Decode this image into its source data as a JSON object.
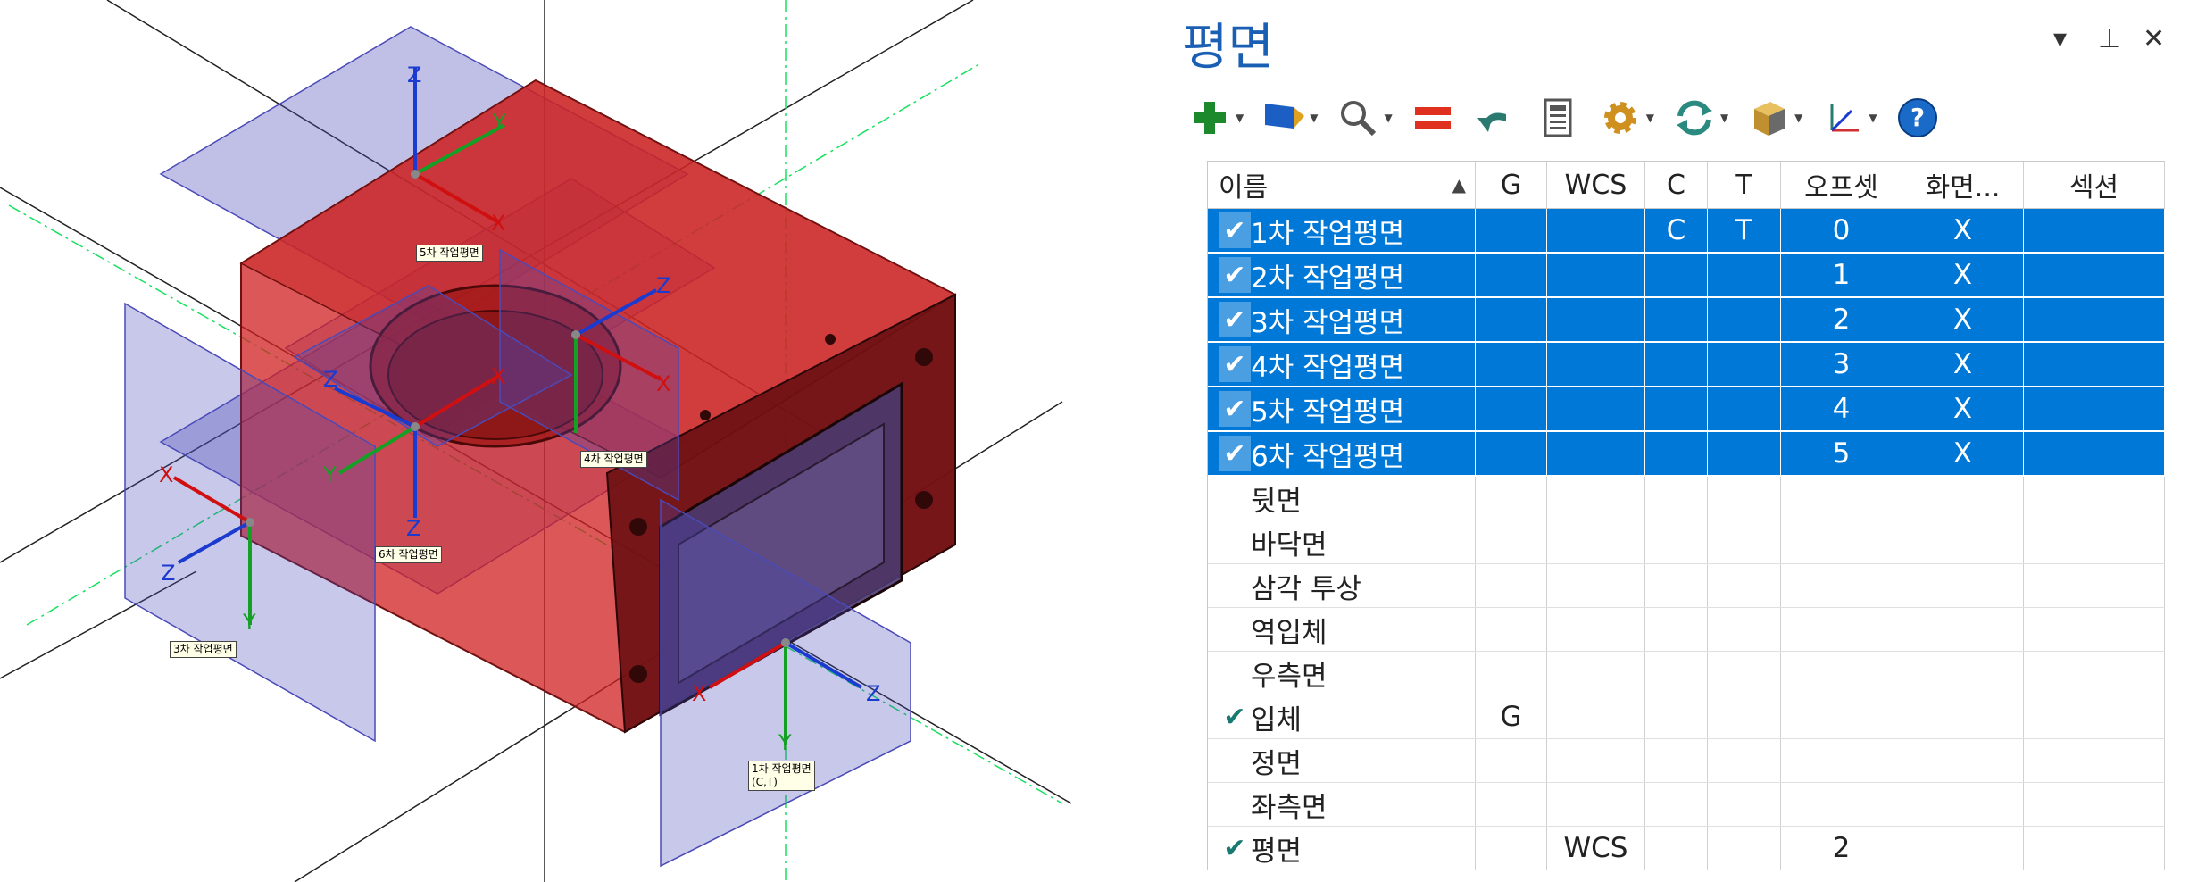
{
  "viewport": {
    "plane_tags": [
      {
        "label": "5차 작업평면"
      },
      {
        "label": "4차 작업평면"
      },
      {
        "label": "6차 작업평면"
      },
      {
        "label": "3차 작업평면"
      },
      {
        "label": "1차 작업평면\n(C,T)"
      }
    ],
    "axis_labels": {
      "x": "X",
      "y": "Y",
      "z": "Z"
    }
  },
  "panel": {
    "title": "평면",
    "controls": {
      "dropdown": "▾",
      "pin": "⊥",
      "close": "✕"
    },
    "toolbar": [
      {
        "icon": "add-plus-icon"
      },
      {
        "icon": "flag-icon"
      },
      {
        "icon": "magnifier-icon"
      },
      {
        "icon": "equal-bars-icon"
      },
      {
        "icon": "undo-arrow-icon"
      },
      {
        "icon": "calculator-icon"
      },
      {
        "icon": "gear-icon"
      },
      {
        "icon": "refresh-icon"
      },
      {
        "icon": "cube-view-icon"
      },
      {
        "icon": "axes-icon"
      },
      {
        "icon": "help-icon"
      }
    ],
    "headers": [
      "이름",
      "G",
      "WCS",
      "C",
      "T",
      "오프셋",
      "화면...",
      "섹션"
    ],
    "rows": [
      {
        "check": "✔",
        "name": "1차 작업평면",
        "g": "",
        "wcs": "",
        "c": "C",
        "t": "T",
        "offset": "0",
        "screen": "X",
        "section": "",
        "selected": true
      },
      {
        "check": "✔",
        "name": "2차 작업평면",
        "g": "",
        "wcs": "",
        "c": "",
        "t": "",
        "offset": "1",
        "screen": "X",
        "section": "",
        "selected": true
      },
      {
        "check": "✔",
        "name": "3차 작업평면",
        "g": "",
        "wcs": "",
        "c": "",
        "t": "",
        "offset": "2",
        "screen": "X",
        "section": "",
        "selected": true
      },
      {
        "check": "✔",
        "name": "4차 작업평면",
        "g": "",
        "wcs": "",
        "c": "",
        "t": "",
        "offset": "3",
        "screen": "X",
        "section": "",
        "selected": true
      },
      {
        "check": "✔",
        "name": "5차 작업평면",
        "g": "",
        "wcs": "",
        "c": "",
        "t": "",
        "offset": "4",
        "screen": "X",
        "section": "",
        "selected": true
      },
      {
        "check": "✔",
        "name": "6차 작업평면",
        "g": "",
        "wcs": "",
        "c": "",
        "t": "",
        "offset": "5",
        "screen": "X",
        "section": "",
        "selected": true
      },
      {
        "check": "",
        "name": "뒷면",
        "g": "",
        "wcs": "",
        "c": "",
        "t": "",
        "offset": "",
        "screen": "",
        "section": "",
        "selected": false
      },
      {
        "check": "",
        "name": "바닥면",
        "g": "",
        "wcs": "",
        "c": "",
        "t": "",
        "offset": "",
        "screen": "",
        "section": "",
        "selected": false
      },
      {
        "check": "",
        "name": "삼각 투상",
        "g": "",
        "wcs": "",
        "c": "",
        "t": "",
        "offset": "",
        "screen": "",
        "section": "",
        "selected": false
      },
      {
        "check": "",
        "name": "역입체",
        "g": "",
        "wcs": "",
        "c": "",
        "t": "",
        "offset": "",
        "screen": "",
        "section": "",
        "selected": false
      },
      {
        "check": "",
        "name": "우측면",
        "g": "",
        "wcs": "",
        "c": "",
        "t": "",
        "offset": "",
        "screen": "",
        "section": "",
        "selected": false
      },
      {
        "check": "✔",
        "name": "입체",
        "g": "G",
        "wcs": "",
        "c": "",
        "t": "",
        "offset": "",
        "screen": "",
        "section": "",
        "selected": false
      },
      {
        "check": "",
        "name": "정면",
        "g": "",
        "wcs": "",
        "c": "",
        "t": "",
        "offset": "",
        "screen": "",
        "section": "",
        "selected": false
      },
      {
        "check": "",
        "name": "좌측면",
        "g": "",
        "wcs": "",
        "c": "",
        "t": "",
        "offset": "",
        "screen": "",
        "section": "",
        "selected": false
      },
      {
        "check": "✔",
        "name": "평면",
        "g": "",
        "wcs": "WCS",
        "c": "",
        "t": "",
        "offset": "2",
        "screen": "",
        "section": "",
        "selected": false
      }
    ]
  }
}
